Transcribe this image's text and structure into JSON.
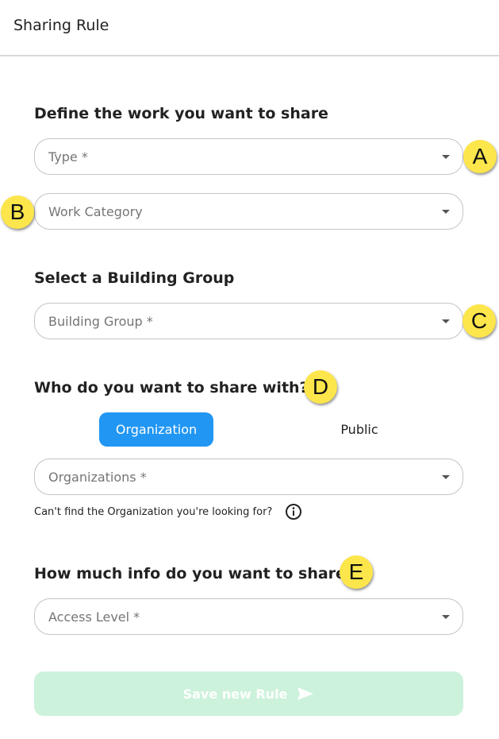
{
  "header": {
    "title": "Sharing Rule"
  },
  "sections": {
    "work": {
      "title": "Define the work you want to share"
    },
    "building": {
      "title": "Select a Building Group"
    },
    "share_with": {
      "title": "Who do you want to share with?"
    },
    "info": {
      "title": "How much info do you want to share?"
    }
  },
  "fields": {
    "type": {
      "label": "Type *"
    },
    "work_category": {
      "label": "Work Category"
    },
    "building_group": {
      "label": "Building Group *"
    },
    "organizations": {
      "label": "Organizations *"
    },
    "access_level": {
      "label": "Access Level *"
    }
  },
  "toggle": {
    "options": [
      "Organization",
      "Public"
    ],
    "selected": "Organization",
    "active_color": "#2196f3"
  },
  "helper": {
    "text": "Can't find the Organization you're looking for?",
    "icon": "info-icon"
  },
  "markers": [
    "A",
    "B",
    "C",
    "D",
    "E"
  ],
  "save_button": {
    "label": "Save new Rule",
    "icon": "send-icon",
    "background": "#cdf2dc"
  },
  "colors": {
    "marker": "#fde64b",
    "border": "#c4c4c4"
  }
}
